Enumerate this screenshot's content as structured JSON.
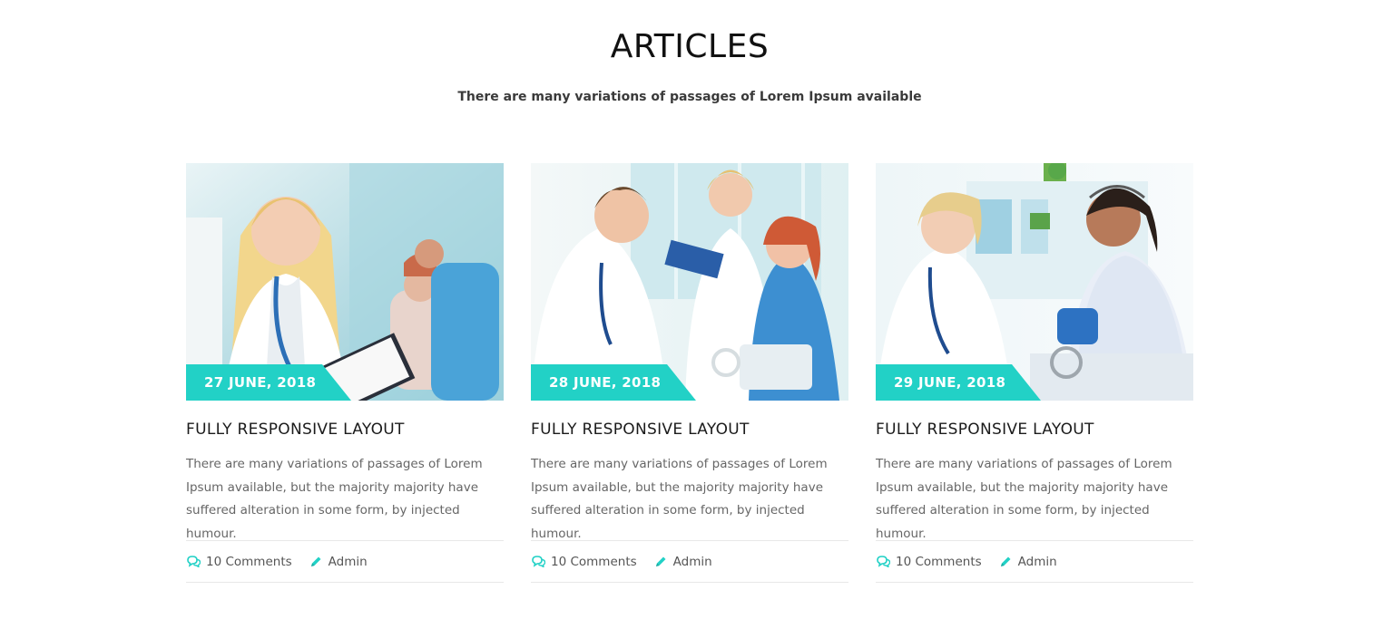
{
  "section": {
    "title": "ARTICLES",
    "subtitle": "There are many variations of passages of Lorem Ipsum available"
  },
  "colors": {
    "accent": "#22d1c6",
    "heading": "#111111",
    "body_text": "#666666",
    "divider": "#e8e8e8"
  },
  "articles": [
    {
      "date": "27 JUNE, 2018",
      "title": "FULLY RESPONSIVE LAYOUT",
      "excerpt": "There are many variations of passages of Lorem Ipsum available, but the majority majority have suffered alteration in some form, by injected humour.",
      "comments": "10 Comments",
      "author": "Admin",
      "comments_icon": "comments-icon",
      "author_icon": "pencil-icon"
    },
    {
      "date": "28 JUNE, 2018",
      "title": "FULLY RESPONSIVE LAYOUT",
      "excerpt": "There are many variations of passages of Lorem Ipsum available, but the majority majority have suffered alteration in some form, by injected humour.",
      "comments": "10 Comments",
      "author": "Admin",
      "comments_icon": "comments-icon",
      "author_icon": "pencil-icon"
    },
    {
      "date": "29 JUNE, 2018",
      "title": "FULLY RESPONSIVE LAYOUT",
      "excerpt": "There are many variations of passages of Lorem Ipsum available, but the majority majority have suffered alteration in some form, by injected humour.",
      "comments": "10 Comments",
      "author": "Admin",
      "comments_icon": "comments-icon",
      "author_icon": "pencil-icon"
    }
  ]
}
